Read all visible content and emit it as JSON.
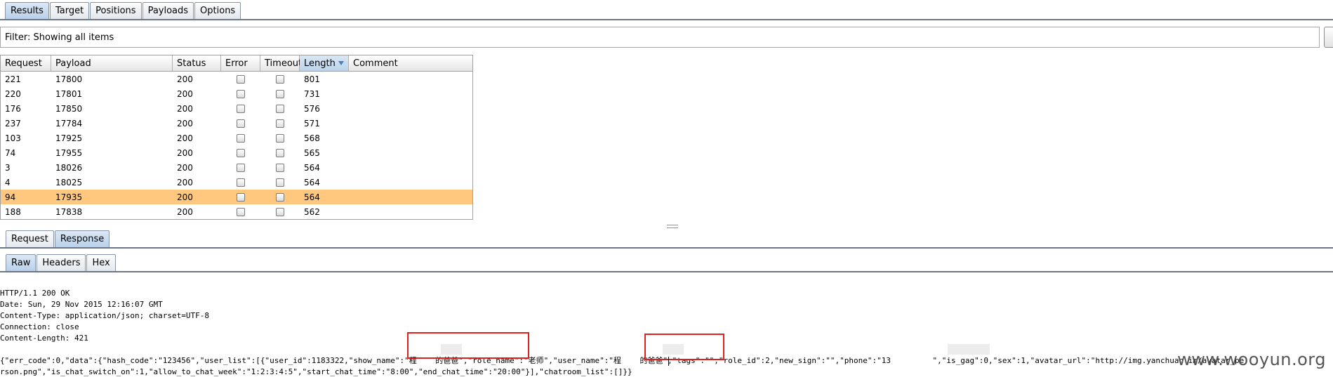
{
  "top_tabs": [
    "Results",
    "Target",
    "Positions",
    "Payloads",
    "Options"
  ],
  "filter": {
    "text": "Filter: Showing all items"
  },
  "table": {
    "columns": [
      "Request",
      "Payload",
      "Status",
      "Error",
      "Timeout",
      "Length",
      "Comment"
    ],
    "sorted_column": "Length",
    "rows": [
      {
        "request": "221",
        "payload": "17800",
        "status": "200",
        "length": "801"
      },
      {
        "request": "220",
        "payload": "17801",
        "status": "200",
        "length": "731"
      },
      {
        "request": "176",
        "payload": "17850",
        "status": "200",
        "length": "576"
      },
      {
        "request": "237",
        "payload": "17784",
        "status": "200",
        "length": "571"
      },
      {
        "request": "103",
        "payload": "17925",
        "status": "200",
        "length": "568"
      },
      {
        "request": "74",
        "payload": "17955",
        "status": "200",
        "length": "565"
      },
      {
        "request": "3",
        "payload": "18026",
        "status": "200",
        "length": "564"
      },
      {
        "request": "4",
        "payload": "18025",
        "status": "200",
        "length": "564"
      },
      {
        "request": "94",
        "payload": "17935",
        "status": "200",
        "length": "564"
      },
      {
        "request": "188",
        "payload": "17838",
        "status": "200",
        "length": "562"
      }
    ],
    "selected_request": "94"
  },
  "reqresp_tabs": [
    "Request",
    "Response"
  ],
  "view_tabs": [
    "Raw",
    "Headers",
    "Hex"
  ],
  "response": {
    "headers": [
      "HTTP/1.1 200 OK",
      "Date: Sun, 29 Nov 2015 12:16:07 GMT",
      "Content-Type: application/json; charset=UTF-8",
      "Connection: close",
      "Content-Length: 421"
    ],
    "body_line1": "{\"err_code\":0,\"data\":{\"hash_code\":\"123456\",\"user_list\":[{\"user_id\":1183322,\"show_name\":\"程    的爸爸\",\"role_name\":\"老师\",\"user_name\":\"程    的爸爸\",\"tags\":\"\",\"role_id\":2,\"new_sign\":\"\",\"phone\":\"13         \",\"is_gag\":0,\"sex\":1,\"avatar_url\":\"http://img.yanchuan.im/avatar_pe",
    "body_line2": "rson.png\",\"is_chat_switch_on\":1,\"allow_to_chat_week\":\"1:2:3:4:5\",\"start_chat_time\":\"8:00\",\"end_chat_time\":\"20:00\"}],\"chatroom_list\":[]}}"
  },
  "watermark": "www.wooyun.org",
  "colors": {
    "selected_row": "#ffc87e",
    "highlight_box": "#e0201f",
    "active_tab": "#c6dbef"
  }
}
